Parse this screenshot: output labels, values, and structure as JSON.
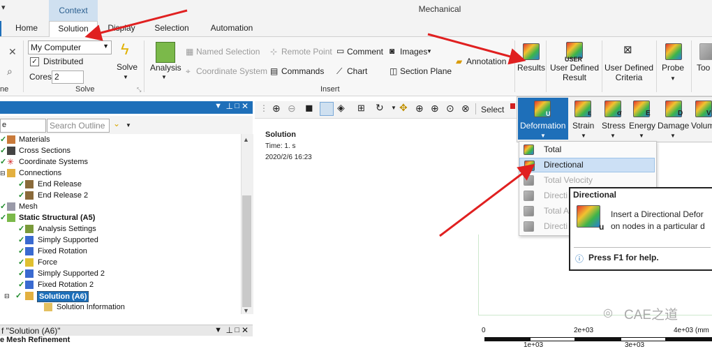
{
  "window": {
    "title": "Mechanical",
    "context_tab": "Context"
  },
  "tabs": [
    {
      "label": "Home"
    },
    {
      "label": "Solution"
    },
    {
      "label": "Display"
    },
    {
      "label": "Selection"
    },
    {
      "label": "Automation"
    }
  ],
  "ribbon": {
    "solve_group": {
      "label": "Solve",
      "computer": "My Computer",
      "distributed": "Distributed",
      "cores_label": "Cores",
      "cores_value": "2",
      "solve_button": "Solve"
    },
    "insert_group": {
      "label": "Insert",
      "analysis": "Analysis",
      "named_selection": "Named Selection",
      "coordinate_system": "Coordinate System",
      "remote_point": "Remote Point",
      "commands": "Commands",
      "comment": "Comment",
      "chart": "Chart",
      "images": "Images",
      "section_plane": "Section Plane",
      "annotation": "Annotation"
    },
    "results": "Results",
    "user_defined_icon_text": "USER",
    "user_defined_result": [
      "User Defined",
      "Result"
    ],
    "user_defined_criteria": [
      "User Defined",
      "Criteria"
    ],
    "probe": "Probe",
    "tools": "Too",
    "left_cut_label": "ne"
  },
  "outline": {
    "filter_value": "e",
    "search_placeholder": "Search Outline",
    "items": [
      {
        "label": "Materials"
      },
      {
        "label": "Cross Sections"
      },
      {
        "label": "Coordinate Systems"
      },
      {
        "label": "Connections"
      },
      {
        "label": "End Release"
      },
      {
        "label": "End Release 2"
      },
      {
        "label": "Mesh"
      },
      {
        "label": "Static Structural (A5)"
      },
      {
        "label": "Analysis Settings"
      },
      {
        "label": "Simply Supported"
      },
      {
        "label": "Fixed Rotation"
      },
      {
        "label": "Force"
      },
      {
        "label": "Simply Supported 2"
      },
      {
        "label": "Fixed Rotation 2"
      },
      {
        "label": "Solution (A6)"
      },
      {
        "label": "Solution Information"
      }
    ]
  },
  "details": {
    "title": "f \"Solution (A6)\"",
    "row": "e Mesh Refinement"
  },
  "graphics_toolbar": {
    "select_label": "Select"
  },
  "viewport": {
    "title": "Solution",
    "time": "Time: 1. s",
    "date": "2020/2/6 16:23",
    "watermark": "CAE之道",
    "scale_labels": [
      "0",
      "2e+03",
      "4e+03 (mm"
    ],
    "scale_labels_lower": [
      "1e+03",
      "3e+03"
    ]
  },
  "deformation_menu": {
    "buttons": [
      {
        "label": "Deformation",
        "letter": "U"
      },
      {
        "label": "Strain",
        "letter": "ε"
      },
      {
        "label": "Stress",
        "letter": "σ"
      },
      {
        "label": "Energy",
        "letter": "E"
      },
      {
        "label": "Damage",
        "letter": "D"
      },
      {
        "label": "Volum",
        "letter": "V"
      }
    ],
    "items": [
      {
        "label": "Total",
        "enabled": true
      },
      {
        "label": "Directional",
        "enabled": true,
        "highlighted": true
      },
      {
        "label": "Total Velocity",
        "enabled": false
      },
      {
        "label": "Directi",
        "enabled": false
      },
      {
        "label": "Total A",
        "enabled": false
      },
      {
        "label": "Directi",
        "enabled": false
      }
    ]
  },
  "tooltip": {
    "title": "Directional",
    "line1": "Insert a Directional Defor",
    "line2": "on nodes in a particular d",
    "help": "Press F1 for help."
  },
  "colors": {
    "accent_blue": "#1e6fb9",
    "context_tab": "#cfe0f0",
    "arrow_red": "#e02020",
    "check_green": "#1e8a2a",
    "highlight": "#cce0f5"
  }
}
